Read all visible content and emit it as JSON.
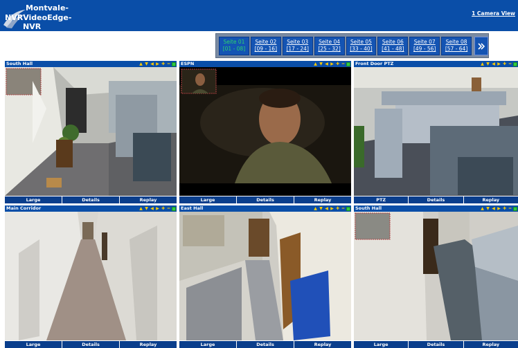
{
  "header": {
    "logo_lines": [
      "Montvale-",
      "NVRVideoEdge-",
      "NVR"
    ],
    "camera_view_link": "1 Camera View",
    "bg_color": "#0a4ea8"
  },
  "pager": {
    "pages": [
      {
        "label": "Seite 01",
        "range": "[01 - 08]",
        "active": true
      },
      {
        "label": "Seite 02",
        "range": "[09 - 16]",
        "active": false
      },
      {
        "label": "Seite 03",
        "range": "[17 - 24]",
        "active": false
      },
      {
        "label": "Seite 04",
        "range": "[25 - 32]",
        "active": false
      },
      {
        "label": "Seite 05",
        "range": "[33 - 40]",
        "active": false
      },
      {
        "label": "Seite 06",
        "range": "[41 - 48]",
        "active": false
      },
      {
        "label": "Seite 07",
        "range": "[49 - 56]",
        "active": false
      },
      {
        "label": "Seite 08",
        "range": "[57 - 64]",
        "active": false
      }
    ],
    "next_icon": "double-chevron-right-icon",
    "active_color": "#2dd36f"
  },
  "cameras": [
    {
      "title": "South Hall",
      "buttons": [
        "Large",
        "Details",
        "Replay"
      ],
      "scene": "office-hall-left"
    },
    {
      "title": "ESPN",
      "buttons": [
        "Large",
        "Details",
        "Replay"
      ],
      "scene": "face-dark"
    },
    {
      "title": "Front Door PTZ",
      "buttons": [
        "PTZ",
        "Details",
        "Replay"
      ],
      "scene": "cubicles"
    },
    {
      "title": "Main Corridor",
      "buttons": [
        "Large",
        "Details",
        "Replay"
      ],
      "scene": "corridor"
    },
    {
      "title": "East Hall",
      "buttons": [
        "Large",
        "Details",
        "Replay"
      ],
      "scene": "hall-right"
    },
    {
      "title": "South Hall",
      "buttons": [
        "Large",
        "Details",
        "Replay"
      ],
      "scene": "hall-wide"
    }
  ],
  "camera_controls": [
    "arrow-up-icon",
    "arrow-down-icon",
    "arrow-left-icon",
    "arrow-right-icon",
    "zoom-in-icon",
    "zoom-out-icon",
    "status-square-icon"
  ]
}
